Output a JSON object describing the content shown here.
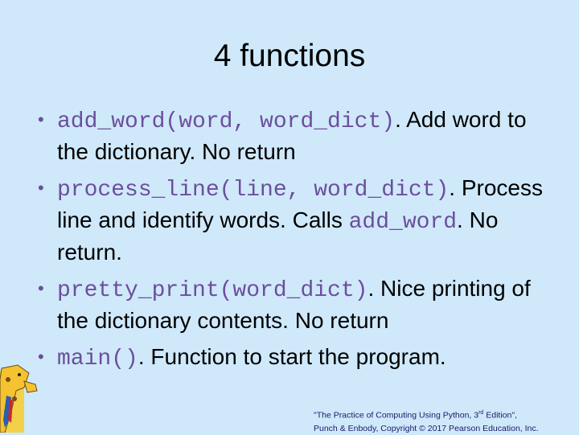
{
  "slide": {
    "title": "4 functions",
    "bullets": [
      {
        "code": "add_word(word, word_dict)",
        "text": ". Add word to the dictionary. No return"
      },
      {
        "code": "process_line(line, word_dict)",
        "text": ". Process line and identify words. Calls ",
        "code2": "add_word",
        "text2": ". No return."
      },
      {
        "code": "pretty_print(word_dict)",
        "text": ". Nice printing of the dictionary contents. No return"
      },
      {
        "code": "main()",
        "text": ". Function to start the program."
      }
    ],
    "footer": {
      "line1_a": "\"The Practice of Computing Using Python, 3",
      "line1_sup": "rd",
      "line1_b": " Edition\",",
      "line2": "Punch & Enbody, Copyright © 2017 Pearson Education, Inc."
    }
  },
  "colors": {
    "background": "#cfe9fb",
    "code": "#6c4e9c",
    "bullet": "#6c4e9c",
    "footer": "#1a1a66"
  },
  "icons": {
    "mascot": "giraffe-mascot-icon"
  }
}
